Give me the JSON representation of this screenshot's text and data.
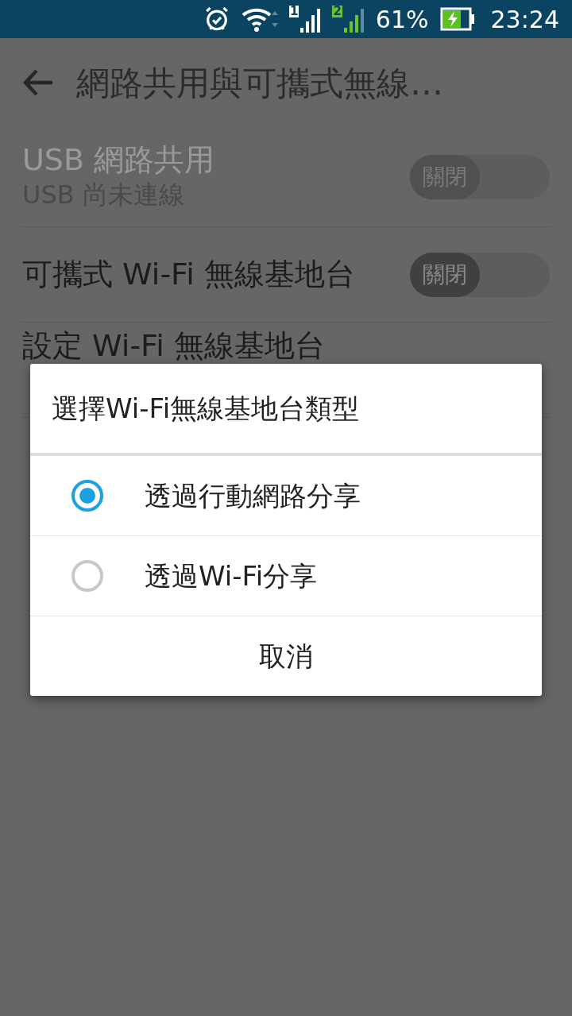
{
  "status_bar": {
    "sim_labels": [
      "1",
      "2"
    ],
    "battery": "61%",
    "charging": true,
    "time": "23:24"
  },
  "app_bar": {
    "title": "網路共用與可攜式無線…"
  },
  "settings": [
    {
      "title": "USB 網路共用",
      "summary": "USB 尚未連線",
      "disabled": true,
      "switch": {
        "label": "關閉",
        "on": false
      }
    },
    {
      "title": "可攜式 Wi-Fi 無線基地台",
      "disabled": false,
      "switch": {
        "label": "關閉",
        "on": false
      }
    },
    {
      "title": "設定 Wi-Fi 無線基地台",
      "disabled": false
    }
  ],
  "dialog": {
    "title": "選擇Wi-Fi無線基地台類型",
    "options": [
      {
        "label": "透過行動網路分享",
        "selected": true
      },
      {
        "label": "透過Wi-Fi分享",
        "selected": false
      }
    ],
    "cancel": "取消"
  }
}
